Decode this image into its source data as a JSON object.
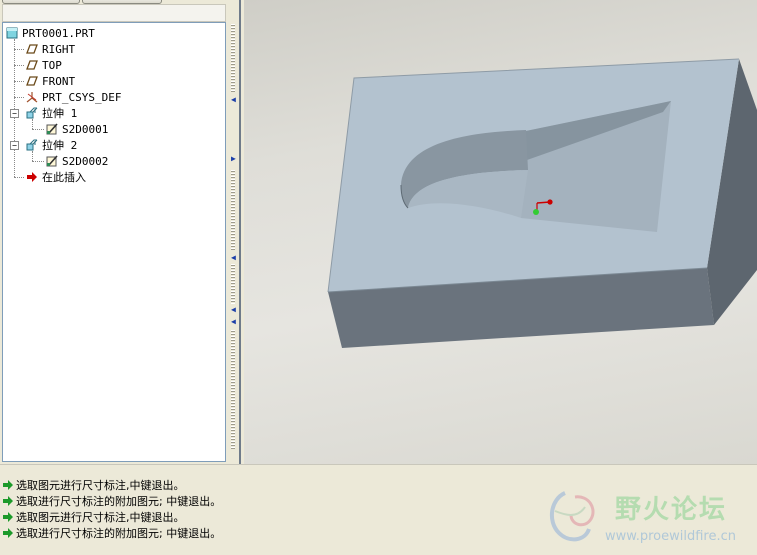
{
  "model_tree": {
    "items": [
      {
        "label": "PRT0001.PRT",
        "icon": "part-icon",
        "level": 0
      },
      {
        "label": "RIGHT",
        "icon": "datum-plane-icon",
        "level": 1
      },
      {
        "label": "TOP",
        "icon": "datum-plane-icon",
        "level": 1
      },
      {
        "label": "FRONT",
        "icon": "datum-plane-icon",
        "level": 1
      },
      {
        "label": "PRT_CSYS_DEF",
        "icon": "coordinate-system-icon",
        "level": 1
      },
      {
        "label": "拉伸 1",
        "icon": "extrude-icon",
        "level": 1,
        "expanded": true
      },
      {
        "label": "S2D0001",
        "icon": "sketch-icon",
        "level": 2
      },
      {
        "label": "拉伸 2",
        "icon": "extrude-icon",
        "level": 1,
        "expanded": true
      },
      {
        "label": "S2D0002",
        "icon": "sketch-icon",
        "level": 2
      },
      {
        "label": "在此插入",
        "icon": "insert-here-arrow-icon",
        "level": 1
      }
    ]
  },
  "messages": [
    "选取图元进行尺寸标注,中键退出。",
    "选取进行尺寸标注的附加图元; 中键退出。",
    "选取图元进行尺寸标注,中键退出。",
    "选取进行尺寸标注的附加图元; 中键退出。"
  ],
  "watermark": {
    "title": "野火论坛",
    "url": "www.proewildfire.cn"
  },
  "colors": {
    "part_top": "#b3c2cf",
    "part_side": "#6a737d",
    "viewport_bg": "#dfded8",
    "message_arrow": "#1c9a2a",
    "insert_arrow": "#cc0000"
  }
}
